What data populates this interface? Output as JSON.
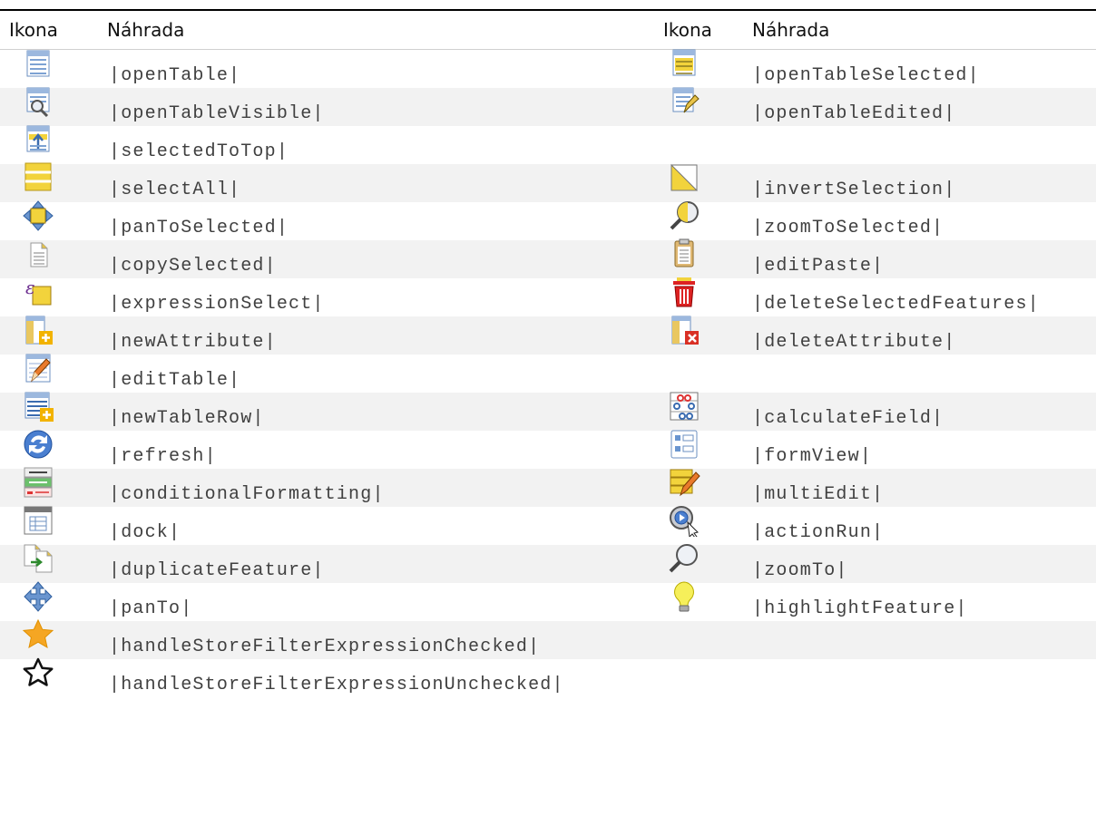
{
  "header": {
    "col1": "Ikona",
    "col2": "Náhrada",
    "col3": "Ikona",
    "col4": "Náhrada"
  },
  "rows": [
    {
      "left": {
        "icon": "open-table-icon",
        "text": "|openTable|"
      },
      "right": {
        "icon": "open-table-selected-icon",
        "text": "|openTableSelected|"
      }
    },
    {
      "left": {
        "icon": "open-table-visible-icon",
        "text": "|openTableVisible|"
      },
      "right": {
        "icon": "open-table-edited-icon",
        "text": "|openTableEdited|"
      }
    },
    {
      "left": {
        "icon": "selected-to-top-icon",
        "text": "|selectedToTop|"
      },
      "right": null
    },
    {
      "left": {
        "icon": "select-all-icon",
        "text": "|selectAll|"
      },
      "right": {
        "icon": "invert-selection-icon",
        "text": "|invertSelection|"
      }
    },
    {
      "left": {
        "icon": "pan-to-selected-icon",
        "text": "|panToSelected|"
      },
      "right": {
        "icon": "zoom-to-selected-icon",
        "text": "|zoomToSelected|"
      }
    },
    {
      "left": {
        "icon": "copy-selected-icon",
        "text": "|copySelected|"
      },
      "right": {
        "icon": "edit-paste-icon",
        "text": "|editPaste|"
      }
    },
    {
      "left": {
        "icon": "expression-select-icon",
        "text": "|expressionSelect|"
      },
      "right": {
        "icon": "delete-selected-features-icon",
        "text": "|deleteSelectedFeatures|"
      }
    },
    {
      "left": {
        "icon": "new-attribute-icon",
        "text": "|newAttribute|"
      },
      "right": {
        "icon": "delete-attribute-icon",
        "text": "|deleteAttribute|"
      }
    },
    {
      "left": {
        "icon": "edit-table-icon",
        "text": "|editTable|"
      },
      "right": null
    },
    {
      "left": {
        "icon": "new-table-row-icon",
        "text": "|newTableRow|"
      },
      "right": {
        "icon": "calculate-field-icon",
        "text": "|calculateField|"
      }
    },
    {
      "left": {
        "icon": "refresh-icon",
        "text": "|refresh|"
      },
      "right": {
        "icon": "form-view-icon",
        "text": "|formView|"
      }
    },
    {
      "left": {
        "icon": "conditional-formatting-icon",
        "text": "|conditionalFormatting|"
      },
      "right": {
        "icon": "multi-edit-icon",
        "text": "|multiEdit|"
      }
    },
    {
      "left": {
        "icon": "dock-icon",
        "text": "|dock|"
      },
      "right": {
        "icon": "action-run-icon",
        "text": "|actionRun|"
      }
    },
    {
      "left": {
        "icon": "duplicate-feature-icon",
        "text": "|duplicateFeature|"
      },
      "right": {
        "icon": "zoom-to-icon",
        "text": "|zoomTo|"
      }
    },
    {
      "left": {
        "icon": "pan-to-icon",
        "text": "|panTo|"
      },
      "right": {
        "icon": "highlight-feature-icon",
        "text": "|highlightFeature|"
      }
    },
    {
      "left": {
        "icon": "star-filled-icon",
        "text": "|handleStoreFilterExpressionChecked|"
      },
      "right": null
    },
    {
      "left": {
        "icon": "star-outline-icon",
        "text": "|handleStoreFilterExpressionUnchecked|"
      },
      "right": null
    }
  ]
}
